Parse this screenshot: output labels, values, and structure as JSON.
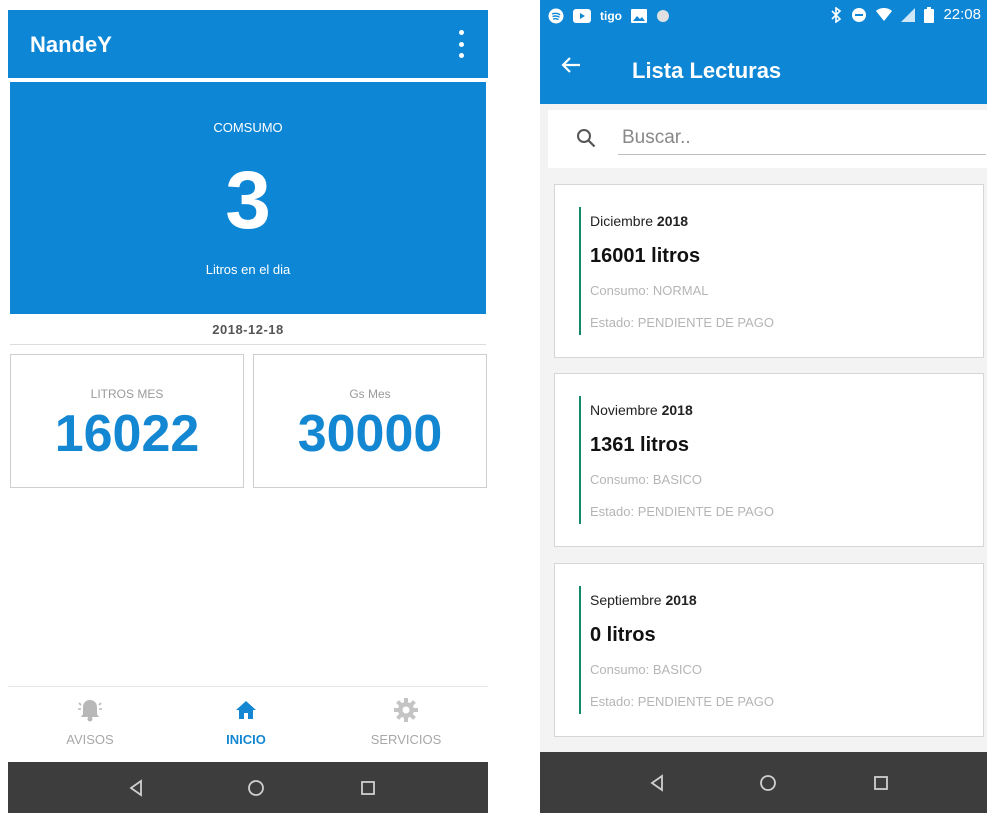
{
  "left_screen": {
    "app_title": "NandeY",
    "hero": {
      "label": "COMSUMO",
      "value": "3",
      "sublabel": "Litros en el dia"
    },
    "date": "2018-12-18",
    "stats": [
      {
        "label": "LITROS MES",
        "value": "16022"
      },
      {
        "label": "Gs Mes",
        "value": "30000"
      }
    ],
    "bottom_nav": [
      {
        "label": "AVISOS",
        "icon": "bell-icon",
        "active": false
      },
      {
        "label": "INICIO",
        "icon": "home-icon",
        "active": true
      },
      {
        "label": "SERVICIOS",
        "icon": "gear-icon",
        "active": false
      }
    ]
  },
  "right_screen": {
    "status_bar": {
      "carrier_text": "tigo",
      "time": "22:08"
    },
    "title": "Lista Lecturas",
    "search": {
      "placeholder": "Buscar..",
      "value": ""
    },
    "readings": [
      {
        "month": "Diciembre",
        "year": "2018",
        "litros": "16001 litros",
        "consumo": "Consumo: NORMAL",
        "estado": "Estado: PENDIENTE DE PAGO"
      },
      {
        "month": "Noviembre",
        "year": "2018",
        "litros": "1361 litros",
        "consumo": "Consumo: BASICO",
        "estado": "Estado: PENDIENTE DE PAGO"
      },
      {
        "month": "Septiembre",
        "year": "2018",
        "litros": "0 litros",
        "consumo": "Consumo: BASICO",
        "estado": "Estado: PENDIENTE DE PAGO"
      }
    ]
  },
  "colors": {
    "primary": "#0d86d6",
    "accent_blue_text": "#1487d3",
    "card_accent": "#128a6a",
    "system_nav": "#3d3d3d"
  }
}
